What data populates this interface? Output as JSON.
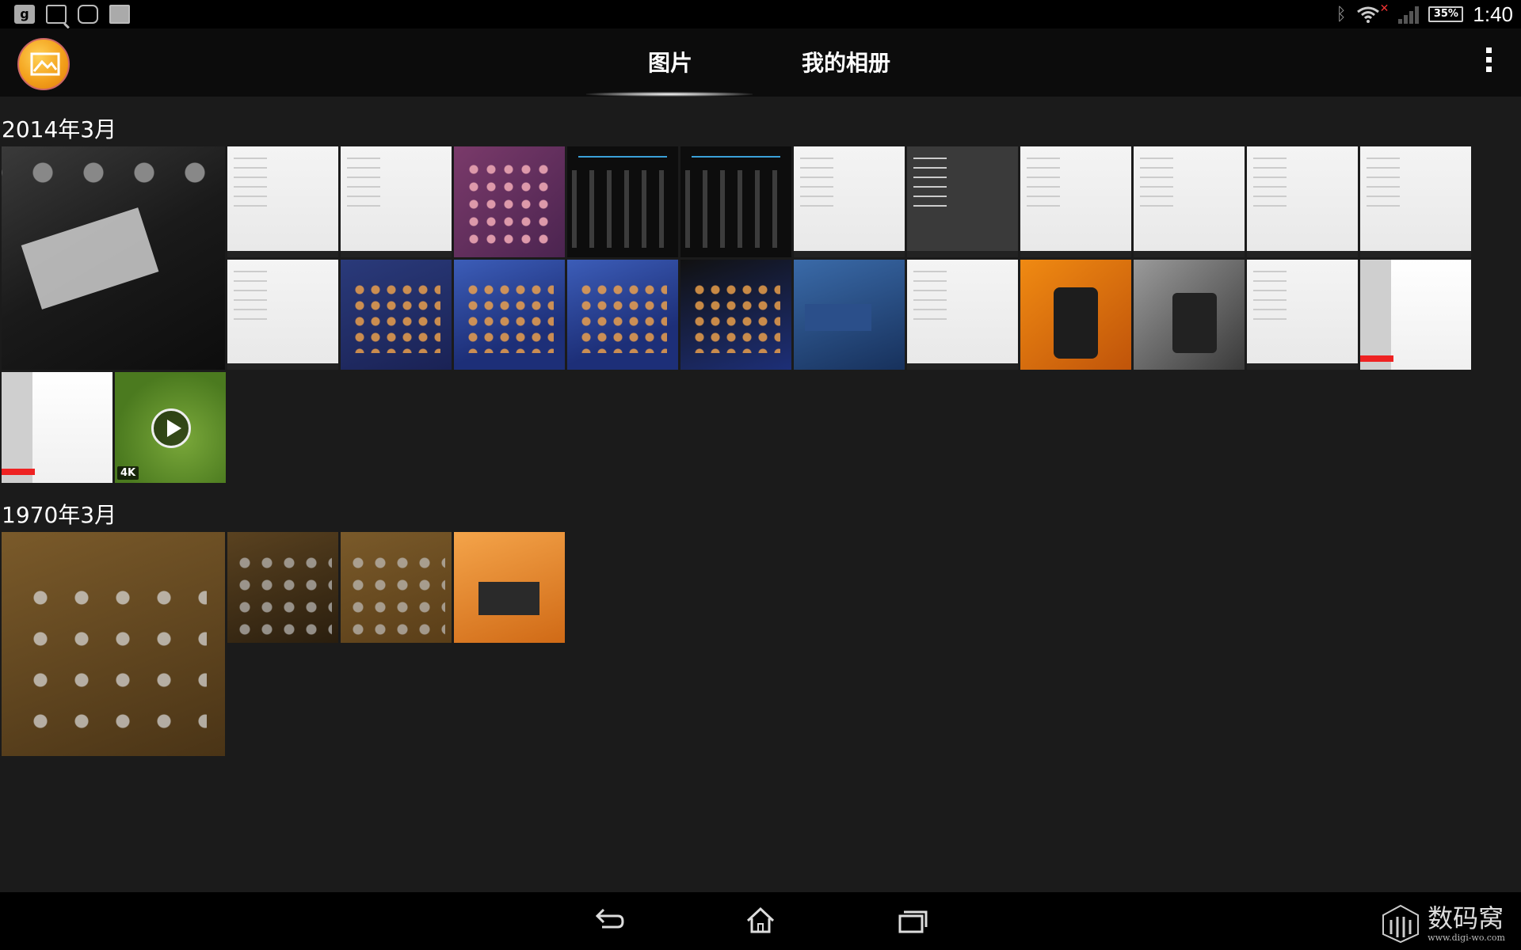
{
  "status_bar": {
    "left_icons": [
      "google-plus-icon",
      "search-notification-icon",
      "android-icon",
      "shopping-bag-icon"
    ],
    "google_glyph": "g",
    "battery": "35%",
    "time": "1:40"
  },
  "action_bar": {
    "app_icon": "album-app-icon",
    "tabs": [
      {
        "label": "图片",
        "selected": true
      },
      {
        "label": "我的相册",
        "selected": false
      }
    ]
  },
  "sections": [
    {
      "header": "2014年3月"
    },
    {
      "header": "1970年3月"
    }
  ],
  "video_badge": "4K",
  "watermark": {
    "text": "数码窝",
    "url": "www.digi-wo.com"
  },
  "colors": {
    "background": "#1b1b1b",
    "accent": "#f3a11c",
    "bar": "#000000"
  }
}
